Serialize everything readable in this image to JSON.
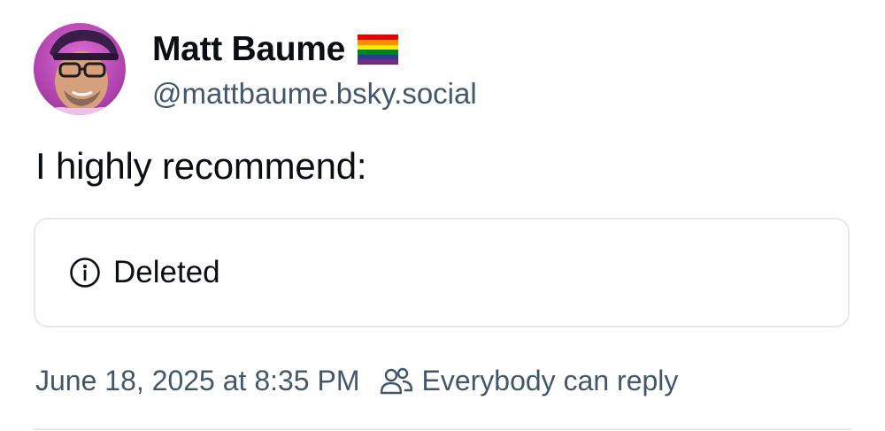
{
  "author": {
    "display_name": "Matt Baume",
    "flag_icon": "rainbow-flag-icon",
    "handle": "@mattbaume.bsky.social",
    "avatar_icon": "avatar"
  },
  "post": {
    "text": "I highly recommend:"
  },
  "quote": {
    "icon": "info-circle-icon",
    "label": "Deleted"
  },
  "meta": {
    "timestamp": "June 18, 2025 at 8:35 PM",
    "reply_icon": "people-icon",
    "reply_setting": "Everybody can reply"
  },
  "colors": {
    "text": "#0b0f14",
    "muted": "#42576c",
    "border": "#e3e8ee"
  }
}
